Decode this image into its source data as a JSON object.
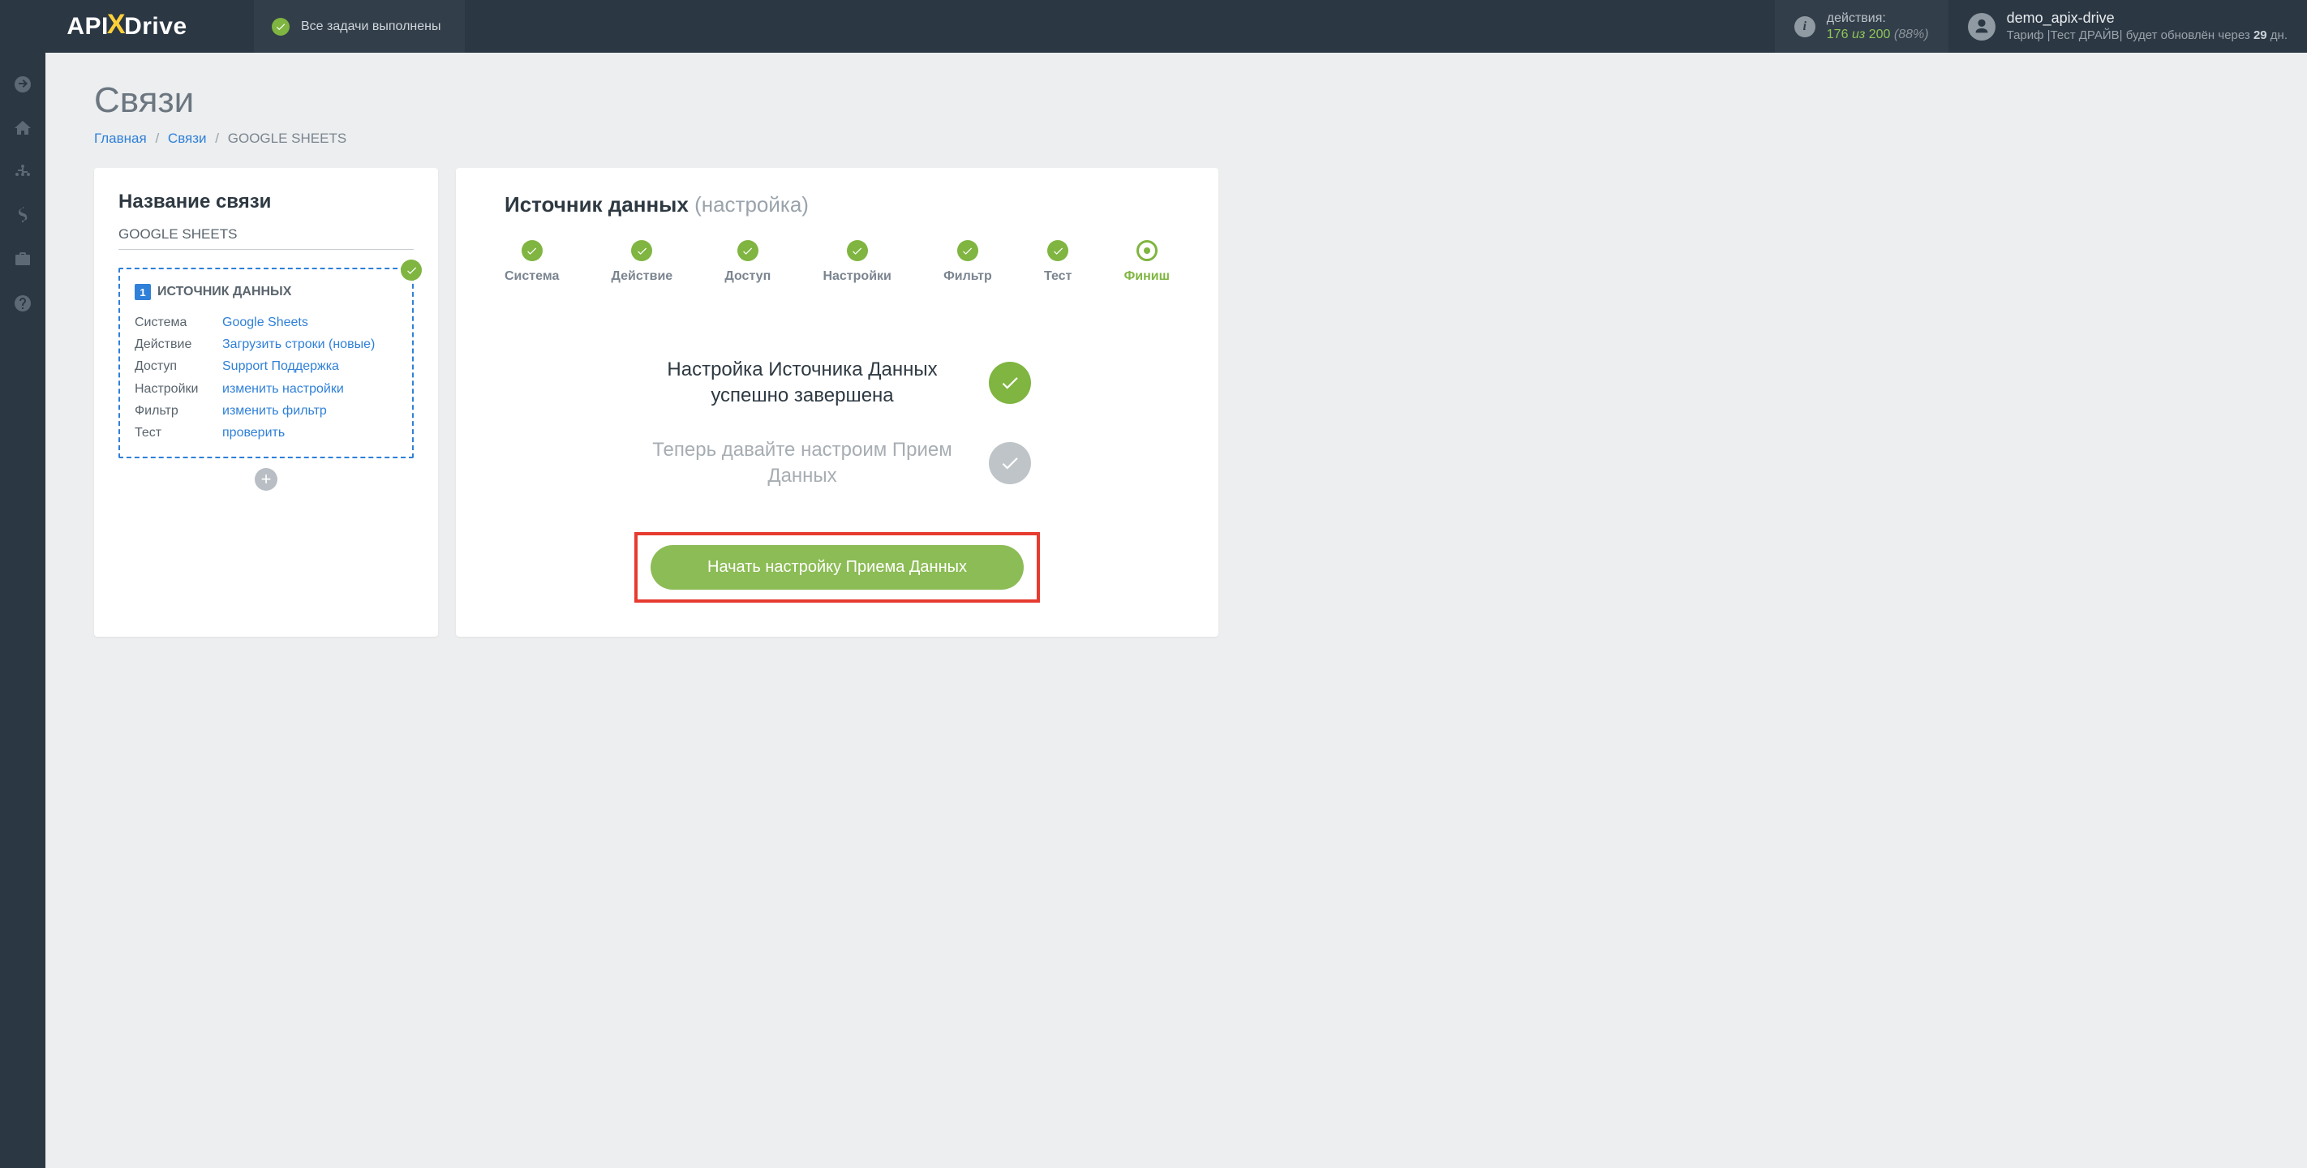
{
  "header": {
    "logo_pre": "API",
    "logo_post": "Drive",
    "tasks_label": "Все задачи выполнены",
    "actions": {
      "label": "действия:",
      "used": "176",
      "of": "из",
      "total": "200",
      "pct": "(88%)"
    },
    "user": {
      "name": "demo_apix-drive",
      "tariff_prefix": "Тариф |Тест ДРАЙВ| будет обновлён через ",
      "tariff_days": "29",
      "tariff_suffix": " дн."
    }
  },
  "breadcrumbs": {
    "home": "Главная",
    "links": "Связи",
    "current": "GOOGLE SHEETS"
  },
  "page_title": "Связи",
  "left": {
    "title": "Название связи",
    "conn_name": "GOOGLE SHEETS",
    "source_head": "ИСТОЧНИК ДАННЫХ",
    "source_num": "1",
    "rows": [
      {
        "k": "Система",
        "v": "Google Sheets"
      },
      {
        "k": "Действие",
        "v": "Загрузить строки (новые)"
      },
      {
        "k": "Доступ",
        "v": "Support Поддержка"
      },
      {
        "k": "Настройки",
        "v": "изменить настройки"
      },
      {
        "k": "Фильтр",
        "v": "изменить фильтр"
      },
      {
        "k": "Тест",
        "v": "проверить"
      }
    ]
  },
  "right": {
    "title": "Источник данных",
    "sub": "(настройка)",
    "steps": [
      {
        "label": "Система",
        "state": "done"
      },
      {
        "label": "Действие",
        "state": "done"
      },
      {
        "label": "Доступ",
        "state": "done"
      },
      {
        "label": "Настройки",
        "state": "done"
      },
      {
        "label": "Фильтр",
        "state": "done"
      },
      {
        "label": "Тест",
        "state": "done"
      },
      {
        "label": "Финиш",
        "state": "current"
      }
    ],
    "status_done": "Настройка Источника Данных успешно завершена",
    "status_pending": "Теперь давайте настроим Прием Данных",
    "cta": "Начать настройку Приема Данных"
  }
}
